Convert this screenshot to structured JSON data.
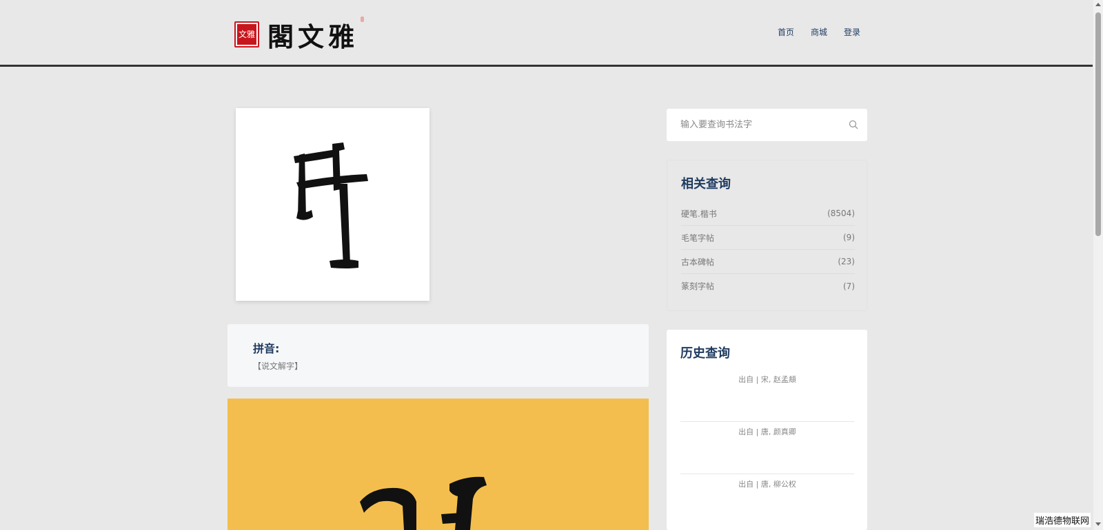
{
  "header": {
    "logo_text": "閣文雅",
    "seal_text": "文雅",
    "nav": [
      {
        "label": "首页"
      },
      {
        "label": "商城"
      },
      {
        "label": "登录"
      }
    ]
  },
  "pinyin": {
    "title": "拼音:",
    "source": "【说文解字】"
  },
  "search": {
    "placeholder": "输入要查询书法字"
  },
  "related": {
    "title": "相关查询",
    "items": [
      {
        "label": "硬笔.楷书",
        "count": "(8504)"
      },
      {
        "label": "毛笔字帖",
        "count": "(9)"
      },
      {
        "label": "古本碑帖",
        "count": "(23)"
      },
      {
        "label": "篆刻字帖",
        "count": "(7)"
      }
    ]
  },
  "history": {
    "title": "历史查询",
    "items": [
      {
        "text": "出自 | 宋, 赵孟頫"
      },
      {
        "text": "出自 | 唐, 颜真卿"
      },
      {
        "text": "出自 | 唐, 柳公权"
      }
    ]
  },
  "watermark": "瑞浩德物联网",
  "colors": {
    "accent": "#1e3a5f",
    "yellow_panel": "#f4be4e",
    "seal_red": "#c8161d"
  }
}
